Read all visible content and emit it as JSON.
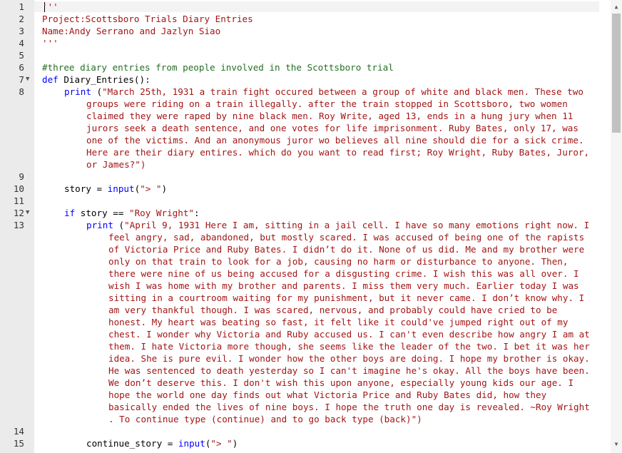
{
  "line_numbers": [
    "1",
    "2",
    "3",
    "4",
    "5",
    "6",
    "7",
    "8",
    "9",
    "10",
    "11",
    "12",
    "13",
    "14",
    "15"
  ],
  "lines": {
    "l1": "'''",
    "l2": "Project:Scottsboro Trials Diary Entries",
    "l3": "Name:Andy Serrano and Jazlyn Siao",
    "l4": "'''",
    "l6": "#three diary entries from people involved in the Scottsboro trial",
    "l7_kw": "def",
    "l7_rest": " Diary_Entries():",
    "l8_kw": "print",
    "l8_paren": " (",
    "l8_str": [
      "\"March 25th, 1931 a train fight occured between a group of white and black men. These two",
      "groups were riding on a train illegally. after the train stopped in Scottsboro, two women",
      "claimed they were raped by nine black men. Roy Write, aged 13, ends in a hung jury when 11",
      "jurors seek a death sentence, and one votes for life imprisonment. Ruby Bates, only 17, was",
      "one of the victims. And an anonymous juror wo believes all nine should die for a sick crime.",
      "Here are their diary entires. which do you want to read first; Roy Wright, Ruby Bates, Juror,",
      "or James?\")"
    ],
    "l10_a": "story = ",
    "l10_fn": "input",
    "l10_b": "(",
    "l10_str": "\"> \"",
    "l10_c": ")",
    "l12_kw": "if",
    "l12_a": " story == ",
    "l12_str": "\"Roy Wright\"",
    "l12_b": ":",
    "l13_kw": "print",
    "l13_paren": " (",
    "l13_str": [
      "\"April 9, 1931 Here I am, sitting in a jail cell. I have so many emotions right now. I",
      "feel angry, sad, abandoned, but mostly scared. I was accused of being one of the rapists",
      "of Victoria Price and Ruby Bates. I didn’t do it. None of us did. Me and my brother were",
      "only on that train to look for a job, causing no harm or disturbance to anyone. Then,",
      "there were nine of us being accused for a disgusting crime. I wish this was all over. I",
      "wish I was home with my brother and parents. I miss them very much. Earlier today I was",
      "sitting in a courtroom waiting for my punishment, but it never came. I don’t know why. I",
      "am very thankful though. I was scared, nervous, and probably could have cried to be",
      "honest. My heart was beating so fast, it felt like it could've jumped right out of my",
      "chest. I wonder why Victoria and Ruby accused us. I can't even describe how angry I am at",
      "them. I hate Victoria more though, she seems like the leader of the two. I bet it was her",
      "idea. She is pure evil. I wonder how the other boys are doing. I hope my brother is okay.",
      "He was sentenced to death yesterday so I can't imagine he's okay. All the boys have been.",
      "We don’t deserve this. I don't wish this upon anyone, especially young kids our age. I",
      "hope the world one day finds out what Victoria Price and Ruby Bates did, how they",
      "basically ended the lives of nine boys. I hope the truth one day is revealed. ~Roy Wright",
      ". To continue type (continue) and to go back type (back)\")"
    ],
    "l15_a": "continue_story = ",
    "l15_fn": "input",
    "l15_b": "(",
    "l15_str": "\"> \"",
    "l15_c": ")"
  },
  "icons": {
    "fold": "fold-arrow-icon",
    "scroll_up": "scroll-up-icon",
    "scroll_down": "scroll-down-icon"
  },
  "colors": {
    "comment": "#236e24",
    "keyword": "#0000ff",
    "string": "#a31515",
    "gutter": "#ebebeb"
  }
}
